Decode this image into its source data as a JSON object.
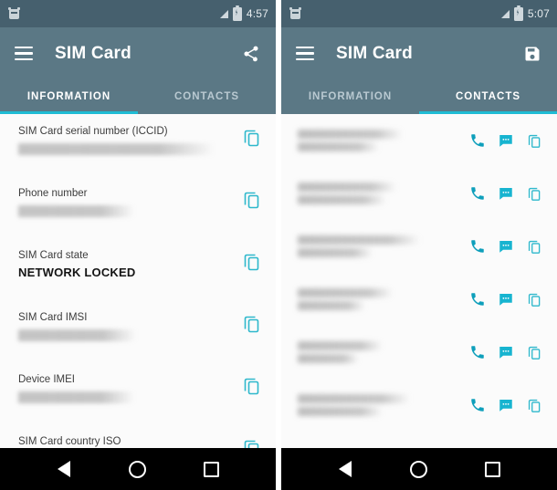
{
  "app": {
    "title": "SIM Card",
    "accent_color": "#20bcd4",
    "toolbar_color": "#5b7885",
    "statusbar_color": "#46606e"
  },
  "screens": [
    {
      "id": "information-screen",
      "statusbar": {
        "time": "4:57",
        "icons": [
          "app-notification-icon",
          "signal-icon",
          "battery-icon"
        ]
      },
      "toolbar": {
        "menu_icon": "hamburger-menu-icon",
        "title": "SIM Card",
        "action_icon": "share-icon"
      },
      "tabs": [
        {
          "label": "INFORMATION",
          "active": true
        },
        {
          "label": "CONTACTS",
          "active": false
        }
      ],
      "rows": [
        {
          "label": "SIM Card serial number (ICCID)",
          "value": "",
          "redacted": true,
          "redacted_width": "88%",
          "copy_icon": "copy-icon"
        },
        {
          "label": "Phone number",
          "value": "",
          "redacted": true,
          "redacted_width": "52%",
          "copy_icon": "copy-icon"
        },
        {
          "label": "SIM Card state",
          "value": "NETWORK LOCKED",
          "redacted": false,
          "copy_icon": "copy-icon"
        },
        {
          "label": "SIM Card IMSI",
          "value": "",
          "redacted": true,
          "redacted_width": "53%",
          "copy_icon": "copy-icon"
        },
        {
          "label": "Device IMEI",
          "value": "",
          "redacted": true,
          "redacted_width": "52%",
          "copy_icon": "copy-icon"
        },
        {
          "label": "SIM Card country ISO",
          "value": "",
          "redacted": true,
          "redacted_width": "13%",
          "copy_icon": "copy-icon"
        }
      ],
      "navbar": {
        "back": "back-icon",
        "home": "home-icon",
        "recents": "recents-icon"
      }
    },
    {
      "id": "contacts-screen",
      "statusbar": {
        "time": "5:07",
        "icons": [
          "app-notification-icon",
          "signal-icon",
          "battery-icon"
        ]
      },
      "toolbar": {
        "menu_icon": "hamburger-menu-icon",
        "title": "SIM Card",
        "action_icon": "save-icon"
      },
      "tabs": [
        {
          "label": "INFORMATION",
          "active": false
        },
        {
          "label": "CONTACTS",
          "active": true
        }
      ],
      "contacts": [
        {
          "name": "",
          "number": "",
          "redacted": true,
          "name_width": "62%",
          "number_width": "48%",
          "actions": [
            "call-icon",
            "message-icon",
            "copy-icon"
          ]
        },
        {
          "name": "",
          "number": "",
          "redacted": true,
          "name_width": "58%",
          "number_width": "52%",
          "actions": [
            "call-icon",
            "message-icon",
            "copy-icon"
          ]
        },
        {
          "name": "",
          "number": "",
          "redacted": true,
          "name_width": "72%",
          "number_width": "44%",
          "actions": [
            "call-icon",
            "message-icon",
            "copy-icon"
          ]
        },
        {
          "name": "",
          "number": "",
          "redacted": true,
          "name_width": "56%",
          "number_width": "40%",
          "actions": [
            "call-icon",
            "message-icon",
            "copy-icon"
          ]
        },
        {
          "name": "",
          "number": "",
          "redacted": true,
          "name_width": "50%",
          "number_width": "36%",
          "actions": [
            "call-icon",
            "message-icon",
            "copy-icon"
          ]
        },
        {
          "name": "",
          "number": "",
          "redacted": true,
          "name_width": "66%",
          "number_width": "50%",
          "actions": [
            "call-icon",
            "message-icon",
            "copy-icon"
          ]
        }
      ],
      "navbar": {
        "back": "back-icon",
        "home": "home-icon",
        "recents": "recents-icon"
      }
    }
  ]
}
